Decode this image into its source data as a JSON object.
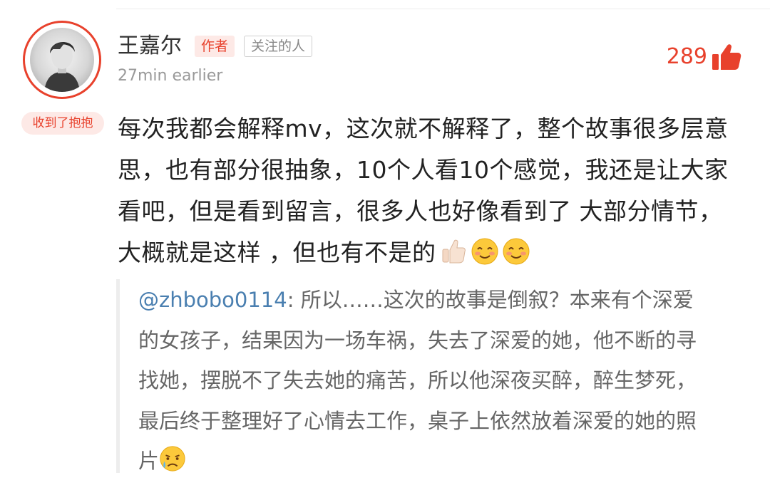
{
  "author": {
    "name": "王嘉尔",
    "author_tag": "作者",
    "follow_tag": "关注的人",
    "timestamp": "27min earlier",
    "badge": "收到了抱抱"
  },
  "likes": {
    "count": "289",
    "icon": "thumbs-up-icon"
  },
  "comment": {
    "text": "每次我都会解释mv，这次就不解释了，整个故事很多层意思，也有部分很抽象，10个人看10个感觉，我还是让大家看吧，但是看到留言，很多人也好像看到了 大部分情节，大概就是这样 ，但也有不是的",
    "emojis": [
      "thumbs-up-emoji",
      "smiling-blush-emoji",
      "smiling-blush-emoji"
    ]
  },
  "quoted_reply": {
    "mention": "@zhbobo0114",
    "text": ": 所以……这次的故事是倒叙？本来有个深爱的女孩子，结果因为一场车祸，失去了深爱的她，他不断的寻找她，摆脱不了失去她的痛苦，所以他深夜买醉，醉生梦死，最后终于整理好了心情去工作，桌子上依然放着深爱的她的照片",
    "emoji": "crying-face-emoji"
  },
  "colors": {
    "accent": "#e8412c",
    "mention": "#4a7fb0",
    "text": "#222222",
    "muted": "#999999"
  }
}
